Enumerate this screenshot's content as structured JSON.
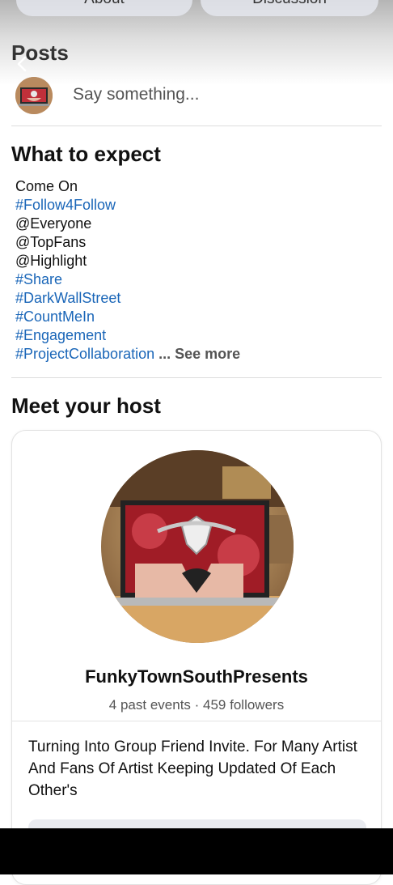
{
  "tabs": {
    "about": "About",
    "discussion": "Discussion"
  },
  "posts": {
    "title": "Posts",
    "composer_placeholder": "Say something..."
  },
  "expect": {
    "title": "What to expect",
    "lines": [
      "Come On",
      "#Follow4Follow",
      "@Everyone",
      "@TopFans",
      "@Highlight",
      "#Share",
      "#DarkWallStreet",
      "#CountMeIn",
      "#Engagement",
      "#ProjectCollaboration"
    ],
    "see_more": "... See more"
  },
  "host": {
    "title": "Meet your host",
    "name": "FunkyTownSouthPresents",
    "stats": "4 past events · 459 followers",
    "description": "Turning Into Group Friend Invite. For Many Artist And Fans Of Artist Keeping Updated Of Each Other's"
  },
  "colors": {
    "link": "#1a66b8",
    "muted": "#555555",
    "divider": "#dcdcdc"
  },
  "icons": {
    "back": "chevron-left-icon"
  }
}
